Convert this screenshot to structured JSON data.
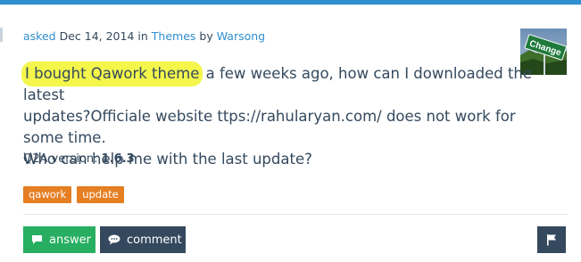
{
  "meta": {
    "asked": "asked",
    "date": "Dec 14, 2014",
    "in": "in",
    "category": "Themes",
    "by": "by",
    "author": "Warsong"
  },
  "avatar": {
    "sign_text": "Change"
  },
  "question": {
    "highlighted": "I bought Qawork theme",
    "rest_line1": " a few weeks ago, how can I downloaded the latest",
    "line2": "updates?Officiale website ttps://rahularyan.com/ does not work for some time.",
    "line3": "Who can help me with the last update?"
  },
  "version": {
    "label": "Q2A version:",
    "value": "1.6.3"
  },
  "tags": [
    "qawork",
    "update"
  ],
  "actions": {
    "answer_label": "answer",
    "comment_label": "comment"
  },
  "colors": {
    "accent": "#2f8fd0",
    "tag": "#e67e22",
    "answer": "#27ae60",
    "dark": "#34495e",
    "highlight": "#f4f64a"
  }
}
